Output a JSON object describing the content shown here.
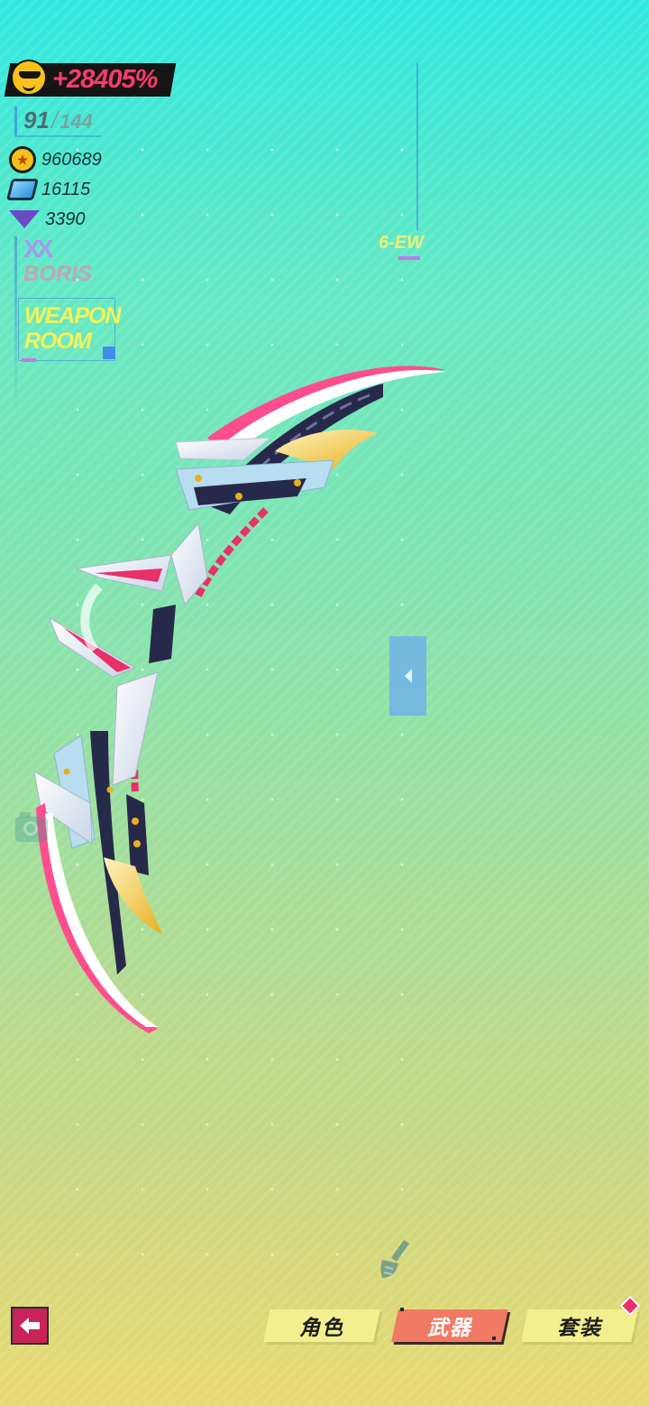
{
  "hud": {
    "power": "+28405%",
    "level": {
      "current": "91",
      "separator": "/",
      "max": "144"
    },
    "resources": [
      {
        "icon": "gold-coin-icon",
        "value": "960689"
      },
      {
        "icon": "blue-gem-icon",
        "value": "16115"
      },
      {
        "icon": "purple-crystal-icon",
        "value": "3390"
      }
    ],
    "player_mark": "XX",
    "player_name": "BORIS",
    "room_title": "WEAPON ROOM",
    "weapon_code": "6-EW"
  },
  "tabs": [
    {
      "id": "character",
      "label": "角色",
      "active": false
    },
    {
      "id": "weapon",
      "label": "武器",
      "active": true
    },
    {
      "id": "suit",
      "label": "套装",
      "active": false,
      "badge": true
    }
  ],
  "colors": {
    "accent_pink": "#ff3a6b",
    "active_tab": "#f07a63",
    "inactive_tab": "#f2ef8e",
    "room_text": "#f3f25a",
    "back_button": "#c9245a",
    "badge": "#e8306a"
  },
  "icons": {
    "back": "back-arrow-icon",
    "camera": "camera-icon",
    "brush": "brush-icon",
    "panel_toggle": "chevron-left-icon",
    "power_emblem": "sunglasses-face-icon"
  }
}
